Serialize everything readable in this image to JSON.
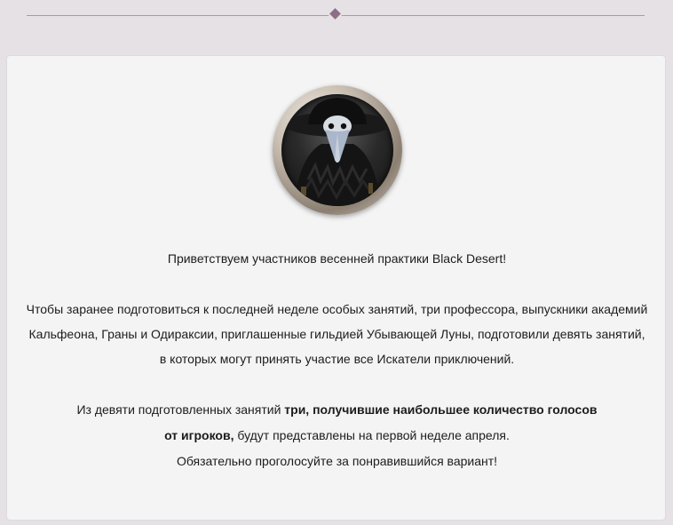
{
  "header": {
    "ornament_icon": "diamond-ornament-icon"
  },
  "avatar": {
    "icon": "plague-doctor-portrait",
    "alt": ""
  },
  "message": {
    "greeting": "Приветствуем участников весенней практики Black Desert!",
    "intro": "Чтобы заранее подготовиться к последней неделе особых занятий, три профессора, выпускники академий Кальфеона, Граны и Одираксии, приглашенные гильдией Убывающей Луны, подготовили девять занятий, в которых могут принять участие все Искатели приключений.",
    "vote_prefix": "Из девяти подготовленных занятий",
    "vote_bold_1": "три, получившие наибольшее количество голосов",
    "vote_bold_2": "от игроков,",
    "vote_suffix": "будут представлены на первой неделе апреля.",
    "call_to_action": "Обязательно проголосуйте за понравившийся вариант!"
  },
  "colors": {
    "page_bg": "#e6e1e4",
    "card_bg": "#f4f4f4",
    "divider": "#a89aa4",
    "ornament": "#8c6f86"
  }
}
